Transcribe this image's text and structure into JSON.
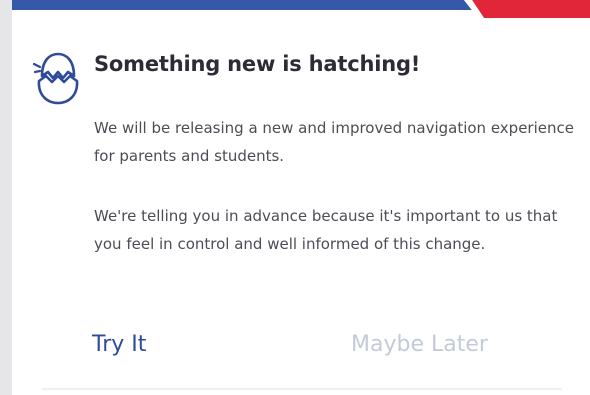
{
  "dialog": {
    "title": "Something new is hatching!",
    "paragraph1": "We will be releasing a new and improved navigation experience for parents and students.",
    "paragraph2": "We're telling you in advance because it's important to us that you feel in control and well informed of this change.",
    "primary_action": "Try It",
    "secondary_action": "Maybe Later",
    "icon": "hatching-egg-icon"
  },
  "colors": {
    "accent_blue": "#2f4b9a",
    "accent_red": "#e2263a",
    "muted_button": "#c3cad8",
    "title_text": "#2c2c36"
  }
}
